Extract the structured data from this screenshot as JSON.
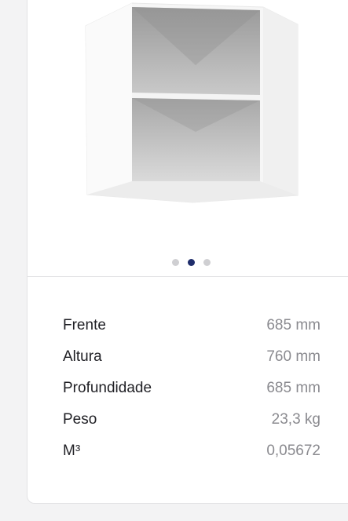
{
  "product": {
    "image_icon": "corner-wall-cabinet-image",
    "carousel": {
      "count": 3,
      "active_index": 1,
      "active_color": "#1f2d6b",
      "inactive_color": "#cfcfd2"
    }
  },
  "specs": [
    {
      "label": "Frente",
      "value": "685 mm"
    },
    {
      "label": "Altura",
      "value": "760 mm"
    },
    {
      "label": "Profundidade",
      "value": "685 mm"
    },
    {
      "label": "Peso",
      "value": "23,3 kg"
    },
    {
      "label": "M³",
      "value": "0,05672"
    }
  ]
}
